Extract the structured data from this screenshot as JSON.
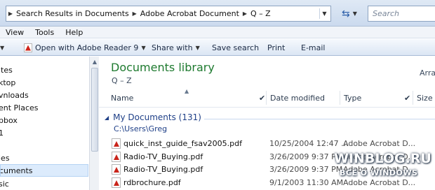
{
  "address": {
    "crumbs": [
      "Search Results in Documents",
      "Adobe Acrobat Document",
      "Q – Z"
    ],
    "search_placeholder": "Search"
  },
  "menu": [
    "View",
    "Tools",
    "Help"
  ],
  "toolbar": {
    "open_with": "Open with Adobe Reader 9",
    "share_with": "Share with",
    "save_search": "Save search",
    "print": "Print",
    "email": "E-mail"
  },
  "nav": {
    "items": [
      "ites",
      "ktop",
      "vnloads",
      "ent Places",
      "pbox",
      "1",
      "ies",
      "cuments",
      "sic"
    ],
    "selected_index": 7
  },
  "library": {
    "title": "Documents library",
    "subtitle": "Q – Z",
    "arrange": "Arra"
  },
  "columns": {
    "name": "Name",
    "date_modified": "Date modified",
    "type": "Type",
    "size": "Size"
  },
  "group": {
    "title": "My Documents (131)",
    "path": "C:\\Users\\Greg"
  },
  "files": [
    {
      "name": "quick_inst_guide_fsav2005.pdf",
      "date": "10/25/2004 12:47 ...",
      "type": "Adobe Acrobat D..."
    },
    {
      "name": "Radio-TV_Buying.pdf",
      "date": "3/26/2009 9:37 PM",
      "type": "Adobe Acrobat D..."
    },
    {
      "name": "Radio-TV_Buying.pdf",
      "date": "3/26/2009 9:37 PM",
      "type": "Adobe Acrobat D..."
    },
    {
      "name": "rdbrochure.pdf",
      "date": "9/1/2003 11:30 AM",
      "type": "Adobe Acrobat D..."
    }
  ],
  "watermark": {
    "main": "WINBLOG.RU",
    "sub": "ВСЁ О WINDOWS"
  }
}
